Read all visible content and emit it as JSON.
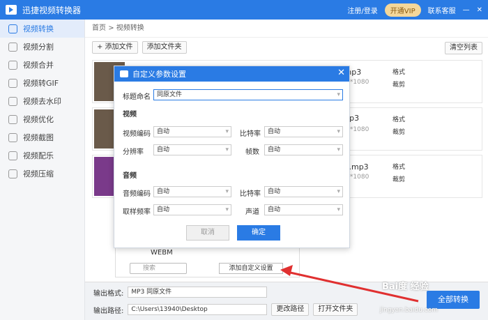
{
  "titlebar": {
    "app_name": "迅捷视频转换器",
    "login": "注册/登录",
    "vip": "开通VIP",
    "support": "联系客服"
  },
  "sidebar": {
    "items": [
      {
        "label": "视频转换"
      },
      {
        "label": "视频分割"
      },
      {
        "label": "视频合并"
      },
      {
        "label": "视频转GIF"
      },
      {
        "label": "视频去水印"
      },
      {
        "label": "视频优化"
      },
      {
        "label": "视频截图"
      },
      {
        "label": "视频配乐"
      },
      {
        "label": "视频压缩"
      }
    ]
  },
  "breadcrumb": {
    "home": "首页",
    "sep": ">",
    "current": "视频转换"
  },
  "toolbar": {
    "add_file": "+ 添加文件",
    "add_folder": "添加文件夹",
    "clear": "清空列表"
  },
  "files": [
    {
      "name": "频.mp3",
      "dims": "1920*1080",
      "fmt": "格式",
      "cut": "裁剪"
    },
    {
      "name": "! .mp3",
      "dims": "1920*1080",
      "fmt": "格式",
      "cut": "裁剪"
    },
    {
      "name": "...主.mp3",
      "dims": "2160*1080",
      "fmt": "格式",
      "cut": "裁剪"
    }
  ],
  "format_panel": {
    "webm": "WEBM",
    "search_placeholder": "搜索",
    "add_custom": "添加自定义设置"
  },
  "bottom": {
    "format_label": "输出格式:",
    "format_value": "MP3  同原文件",
    "path_label": "输出路径:",
    "path_value": "C:\\Users\\13940\\Desktop",
    "change_path": "更改路径",
    "open_folder": "打开文件夹",
    "convert_all": "全部转换"
  },
  "dialog": {
    "title": "自定义参数设置",
    "name_label": "标题命名",
    "name_value": "同原文件",
    "video_section": "视频",
    "audio_section": "音频",
    "video_encoder_label": "视频编码",
    "video_encoder": "自动",
    "bitrate_label": "比特率",
    "bitrate": "自动",
    "resolution_label": "分辨率",
    "resolution": "自动",
    "framerate_label": "帧数",
    "framerate": "自动",
    "audio_encoder_label": "音频编码",
    "audio_encoder": "自动",
    "audio_bitrate_label": "比特率",
    "audio_bitrate": "自动",
    "samplerate_label": "取样频率",
    "samplerate": "自动",
    "channel_label": "声道",
    "channel": "自动",
    "cancel": "取消",
    "ok": "确定"
  },
  "watermark": {
    "brand": "Bai度 经验",
    "url": "jingyan.baidu.com"
  },
  "colors": {
    "accent": "#2a7be4",
    "arrow": "#e03030"
  }
}
